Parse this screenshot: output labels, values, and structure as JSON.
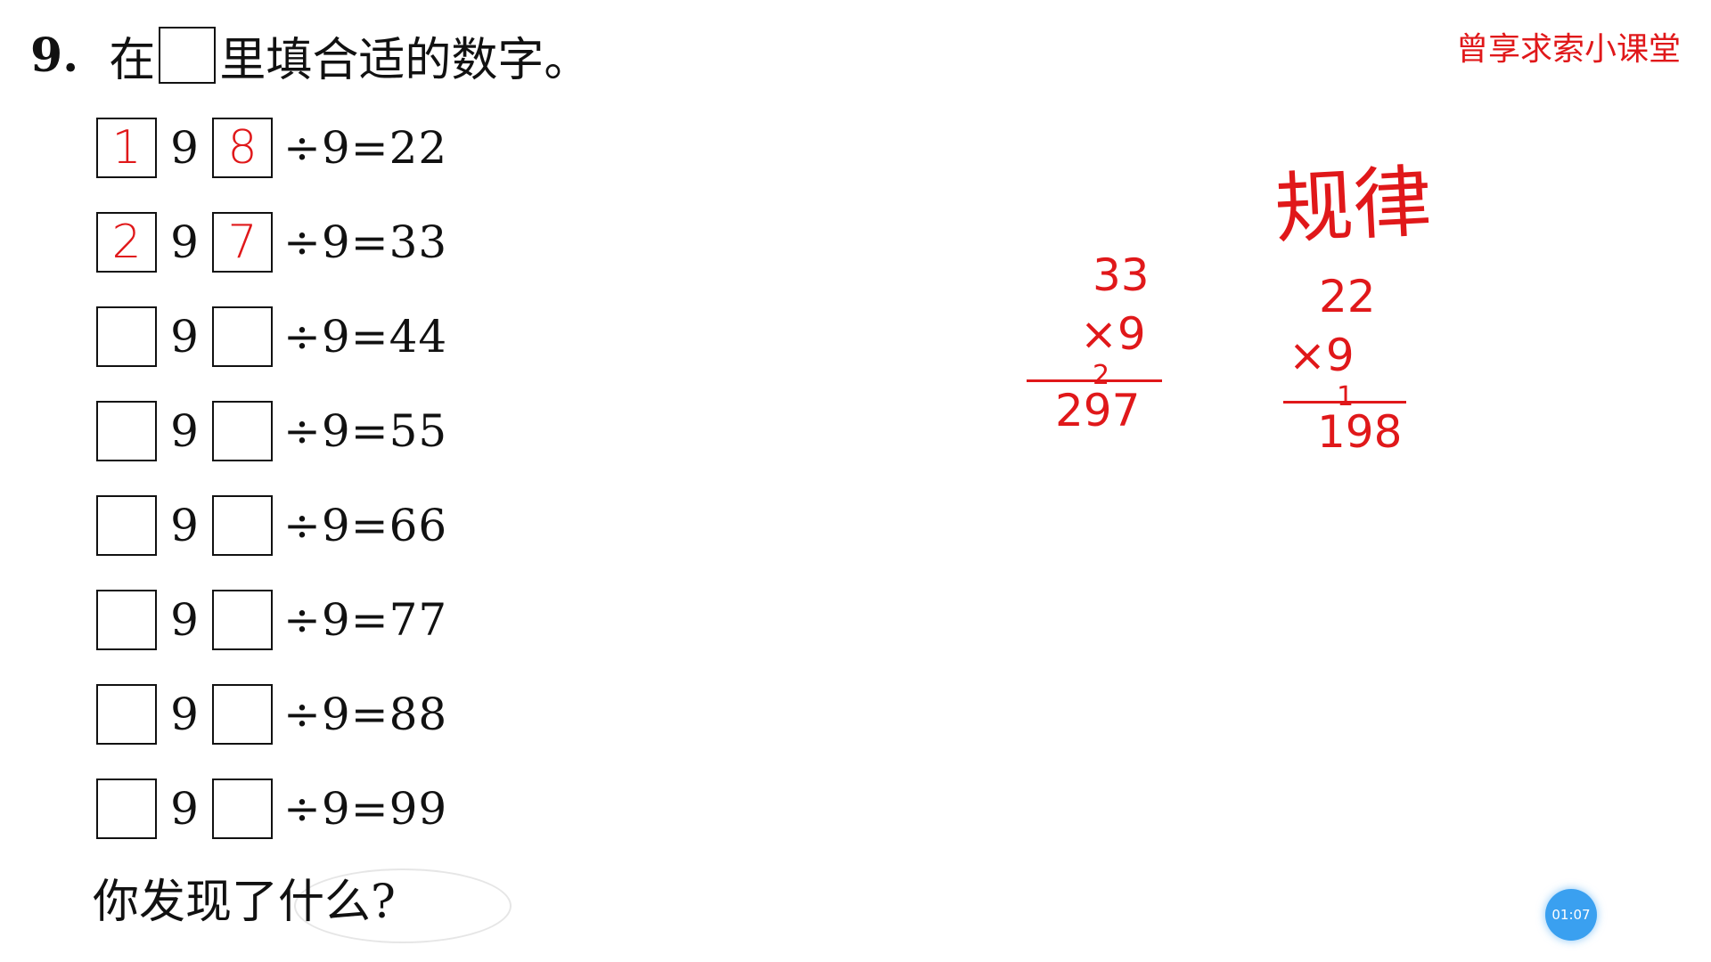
{
  "header": {
    "number": "9.",
    "text_before": "在",
    "text_after": "里填合适的数字。"
  },
  "watermark": "曾享求索小课堂",
  "equations": [
    {
      "left": "1",
      "mid": "9",
      "right": "8",
      "tail": "÷9=22"
    },
    {
      "left": "2",
      "mid": "9",
      "right": "7",
      "tail": "÷9=33"
    },
    {
      "left": "",
      "mid": "9",
      "right": "",
      "tail": "÷9=44"
    },
    {
      "left": "",
      "mid": "9",
      "right": "",
      "tail": "÷9=55"
    },
    {
      "left": "",
      "mid": "9",
      "right": "",
      "tail": "÷9=66"
    },
    {
      "left": "",
      "mid": "9",
      "right": "",
      "tail": "÷9=77"
    },
    {
      "left": "",
      "mid": "9",
      "right": "",
      "tail": "÷9=88"
    },
    {
      "left": "",
      "mid": "9",
      "right": "",
      "tail": "÷9=99"
    }
  ],
  "prompt": "你发现了什么?",
  "handwriting": {
    "title": "规律",
    "calc1": {
      "top": "33",
      "multiplier": "×9",
      "carry": "2",
      "result": "297"
    },
    "calc2": {
      "top": "22",
      "multiplier": "×9",
      "carry": "1",
      "result": "198"
    }
  },
  "timer": "01:07",
  "colors": {
    "ink": "#e0181a",
    "timer": "#3aa0f0"
  }
}
